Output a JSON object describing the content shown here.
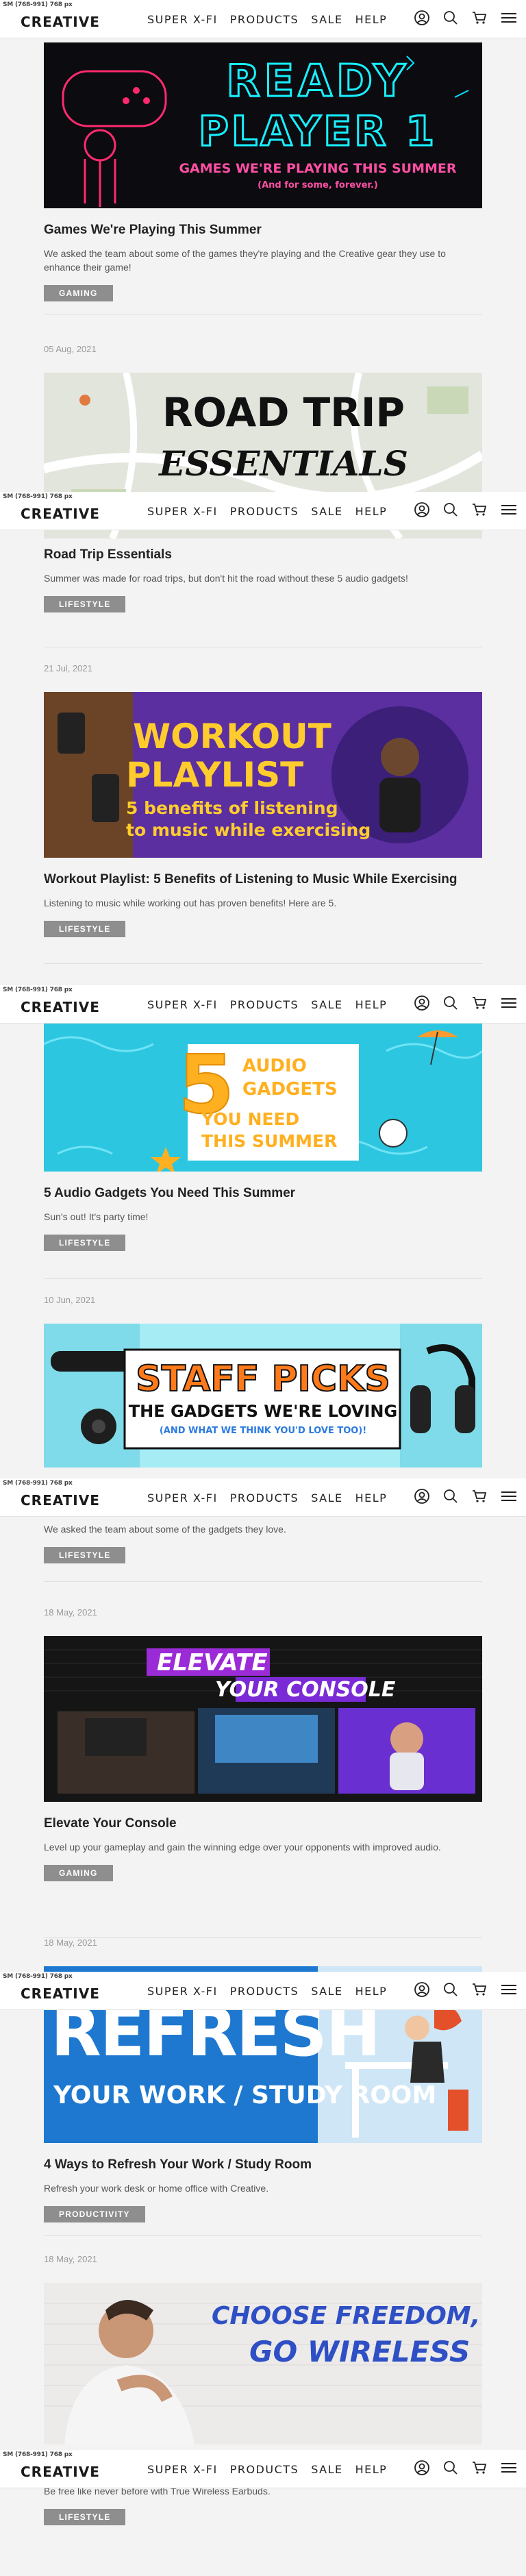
{
  "header": {
    "sm_tag": "SM (768-991) 768 px",
    "logo": "CREATIVE",
    "nav": [
      "SUPER X-FI",
      "PRODUCTS",
      "SALE",
      "HELP"
    ],
    "icons": [
      "user-icon",
      "search-icon",
      "cart-icon",
      "menu-icon"
    ]
  },
  "posts": [
    {
      "date": "",
      "banner": {
        "line1": "READY",
        "line2": "PLAYER 1",
        "line3": "GAMES WE'RE PLAYING THIS SUMMER",
        "line4": "(And for some, forever.)"
      },
      "title": "Games We're Playing This Summer",
      "excerpt": "We asked the team about some of the games they're playing and the Creative gear they use to enhance their game!",
      "tag": "GAMING"
    },
    {
      "date": "05 Aug, 2021",
      "banner": {
        "line1": "ROAD TRIP",
        "line2": "ESSENTIALS"
      },
      "title": "Road Trip Essentials",
      "excerpt": "Summer was made for road trips, but don't hit the road without these 5 audio gadgets!",
      "tag": "LIFESTYLE"
    },
    {
      "date": "21 Jul, 2021",
      "banner": {
        "line1": "WORKOUT",
        "line2": "PLAYLIST",
        "line3": "5 benefits of listening",
        "line4": "to music while exercising"
      },
      "title": "Workout Playlist: 5 Benefits of Listening to Music While Exercising",
      "excerpt": "Listening to music while working out has proven benefits! Here are 5.",
      "tag": "LIFESTYLE"
    },
    {
      "date": "",
      "banner": {
        "line1": "5",
        "line2": "AUDIO",
        "line3": "GADGETS",
        "line4": "YOU NEED",
        "line5": "THIS SUMMER"
      },
      "title": "5 Audio Gadgets You Need This Summer",
      "excerpt": "Sun's out! It's party time!",
      "tag": "LIFESTYLE"
    },
    {
      "date": "10 Jun, 2021",
      "banner": {
        "line1": "STAFF PICKS",
        "line2": "THE GADGETS WE'RE LOVING",
        "line3": "(AND WHAT WE THINK YOU'D LOVE TOO)!"
      },
      "title": "",
      "excerpt": "We asked the team about some of the gadgets they love.",
      "tag": "LIFESTYLE"
    },
    {
      "date": "18 May, 2021",
      "banner": {
        "line1": "ELEVATE",
        "line2": "YOUR CONSOLE"
      },
      "title": "Elevate Your Console",
      "excerpt": "Level up your gameplay and gain the winning edge over your opponents with improved audio.",
      "tag": "GAMING"
    },
    {
      "date": "18 May, 2021",
      "banner": {
        "line1": "REFRESH",
        "line2": "YOUR WORK / STUDY ROOM"
      },
      "title": "4 Ways to Refresh Your Work / Study Room",
      "excerpt": "Refresh your work desk or home office with Creative.",
      "tag": "PRODUCTIVITY"
    },
    {
      "date": "18 May, 2021",
      "banner": {
        "line1": "CHOOSE FREEDOM,",
        "line2": "GO WIRELESS"
      },
      "title": "",
      "excerpt": "Be free like never before with True Wireless Earbuds.",
      "tag": "LIFESTYLE"
    }
  ]
}
